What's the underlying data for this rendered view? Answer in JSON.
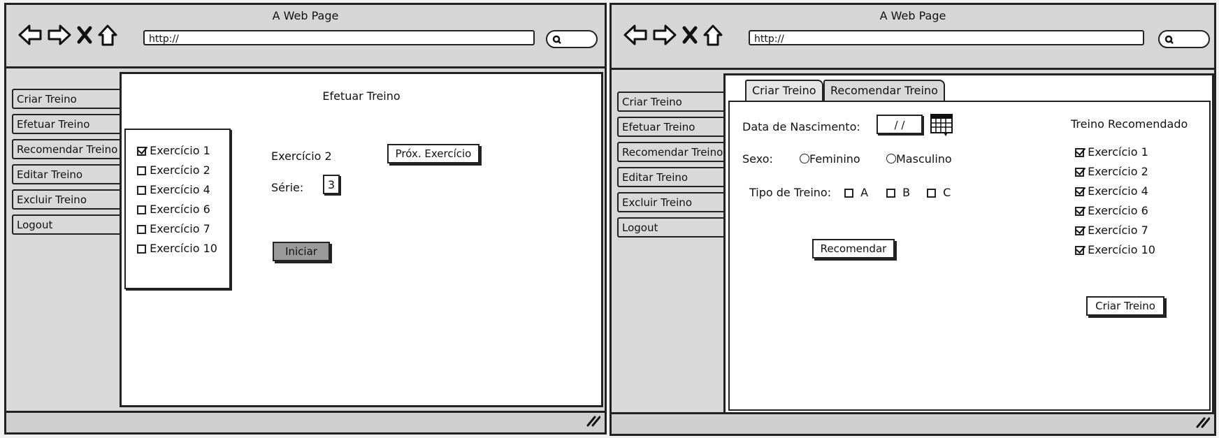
{
  "left_window": {
    "title": "A Web Page",
    "url": "http://",
    "sidebar": {
      "items": [
        {
          "label": "Criar Treino"
        },
        {
          "label": "Efetuar Treino"
        },
        {
          "label": "Recomendar Treino"
        },
        {
          "label": "Editar Treino"
        },
        {
          "label": "Excluir Treino"
        },
        {
          "label": "Logout"
        }
      ]
    },
    "main": {
      "heading": "Efetuar Treino",
      "exercise_list": [
        {
          "label": "Exercício 1",
          "checked": true
        },
        {
          "label": "Exercício 2",
          "checked": false
        },
        {
          "label": "Exercício 4",
          "checked": false
        },
        {
          "label": "Exercício 6",
          "checked": false
        },
        {
          "label": "Exercício 7",
          "checked": false
        },
        {
          "label": "Exercício 10",
          "checked": false
        }
      ],
      "current_exercise": "Exercício 2",
      "next_button": "Próx. Exercício",
      "serie_label": "Série:",
      "serie_value": "3",
      "start_button": "Iniciar"
    }
  },
  "right_window": {
    "title": "A Web Page",
    "url": "http://",
    "sidebar": {
      "items": [
        {
          "label": "Criar Treino"
        },
        {
          "label": "Efetuar Treino"
        },
        {
          "label": "Recomendar Treino"
        },
        {
          "label": "Editar Treino"
        },
        {
          "label": "Excluir Treino"
        },
        {
          "label": "Logout"
        }
      ]
    },
    "tabs": [
      {
        "label": "Criar Treino"
      },
      {
        "label": "Recomendar Treino"
      }
    ],
    "form": {
      "birth_label": "Data de Nascimento:",
      "birth_value": "/ /",
      "sex_label": "Sexo:",
      "sex_options": [
        "Feminino",
        "Masculino"
      ],
      "type_label": "Tipo de Treino:",
      "type_options": [
        "A",
        "B",
        "C"
      ],
      "recommend_button": "Recomendar"
    },
    "recommended": {
      "title": "Treino Recomendado",
      "items": [
        {
          "label": "Exercício 1",
          "checked": true
        },
        {
          "label": "Exercício 2",
          "checked": true
        },
        {
          "label": "Exercício 4",
          "checked": true
        },
        {
          "label": "Exercício 6",
          "checked": true
        },
        {
          "label": "Exercício 7",
          "checked": true
        },
        {
          "label": "Exercício 10",
          "checked": true
        }
      ],
      "create_button": "Criar Treino"
    }
  }
}
